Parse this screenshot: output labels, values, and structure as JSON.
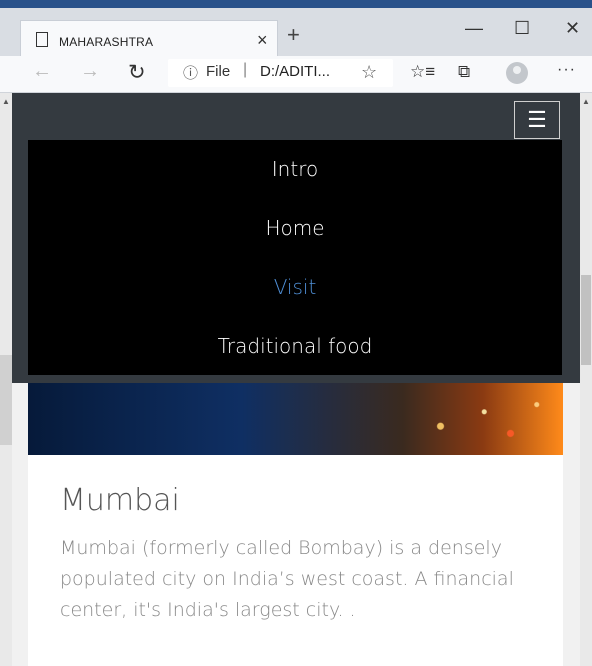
{
  "browser": {
    "tab_title": "MAHARASHTRA",
    "tab_close": "×",
    "new_tab": "+",
    "window_buttons": {
      "minimize": "—",
      "maximize": "☐",
      "close": "✕"
    },
    "nav": {
      "back": "←",
      "forward": "→",
      "refresh": "↻"
    },
    "address": {
      "info": "ⓘ",
      "scheme": "File",
      "separator": "|",
      "path": "D:/ADITI...",
      "favorite": "☆"
    },
    "toolbar": {
      "favorites": "☆≡",
      "collections": "⧉",
      "more": "···"
    }
  },
  "navbar": {
    "toggler": "☰",
    "items": [
      {
        "label": "Intro",
        "active": false
      },
      {
        "label": "Home",
        "active": false
      },
      {
        "label": "Visit",
        "active": true
      },
      {
        "label": "Traditional food",
        "active": false
      }
    ]
  },
  "card": {
    "title": "Mumbai",
    "text": "Mumbai (formerly called Bombay) is a densely populated city on India’s west coast. A financial center, it's India's largest city. ."
  },
  "colors": {
    "active_link": "#4f8fd6",
    "navbar_bg": "#343a40",
    "menu_bg": "#000000"
  }
}
